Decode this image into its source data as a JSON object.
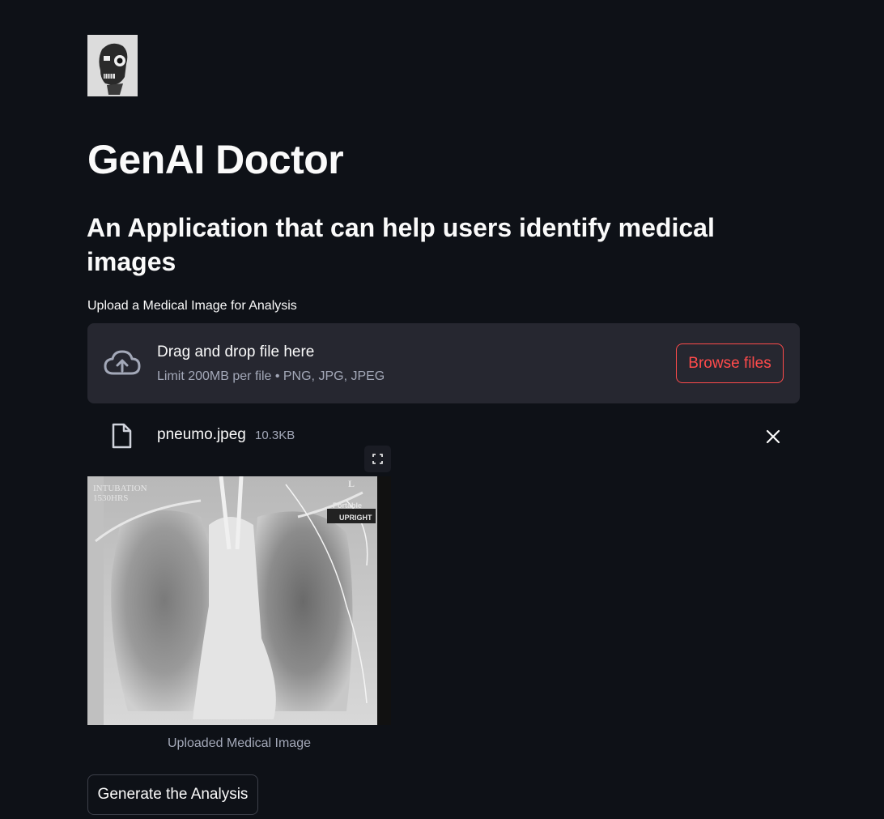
{
  "app": {
    "logo_icon": "robot-skull-logo",
    "title": "GenAI Doctor",
    "subtitle": "An Application that can help users identify medical images"
  },
  "uploader": {
    "label": "Upload a Medical Image for Analysis",
    "drop_text": "Drag and drop file here",
    "limit_text": "Limit 200MB per file • PNG, JPG, JPEG",
    "browse_label": "Browse files",
    "icon": "cloud-upload-icon"
  },
  "uploaded_file": {
    "name": "pneumo.jpeg",
    "size": "10.3KB",
    "icon": "file-icon",
    "remove_icon": "close-icon"
  },
  "image": {
    "overlay_top_left_line1": "INTUBATION",
    "overlay_top_left_line2": "1530HRS",
    "overlay_marker": "L",
    "overlay_top_right_line1": "Portable",
    "overlay_top_right_line2": "UPRIGHT",
    "caption": "Uploaded Medical Image",
    "fullscreen_icon": "fullscreen-icon"
  },
  "actions": {
    "generate_label": "Generate the Analysis"
  },
  "colors": {
    "background": "#0e1117",
    "panel": "#262730",
    "accent": "#ff4b4b",
    "muted_text": "#a3a8b8"
  }
}
